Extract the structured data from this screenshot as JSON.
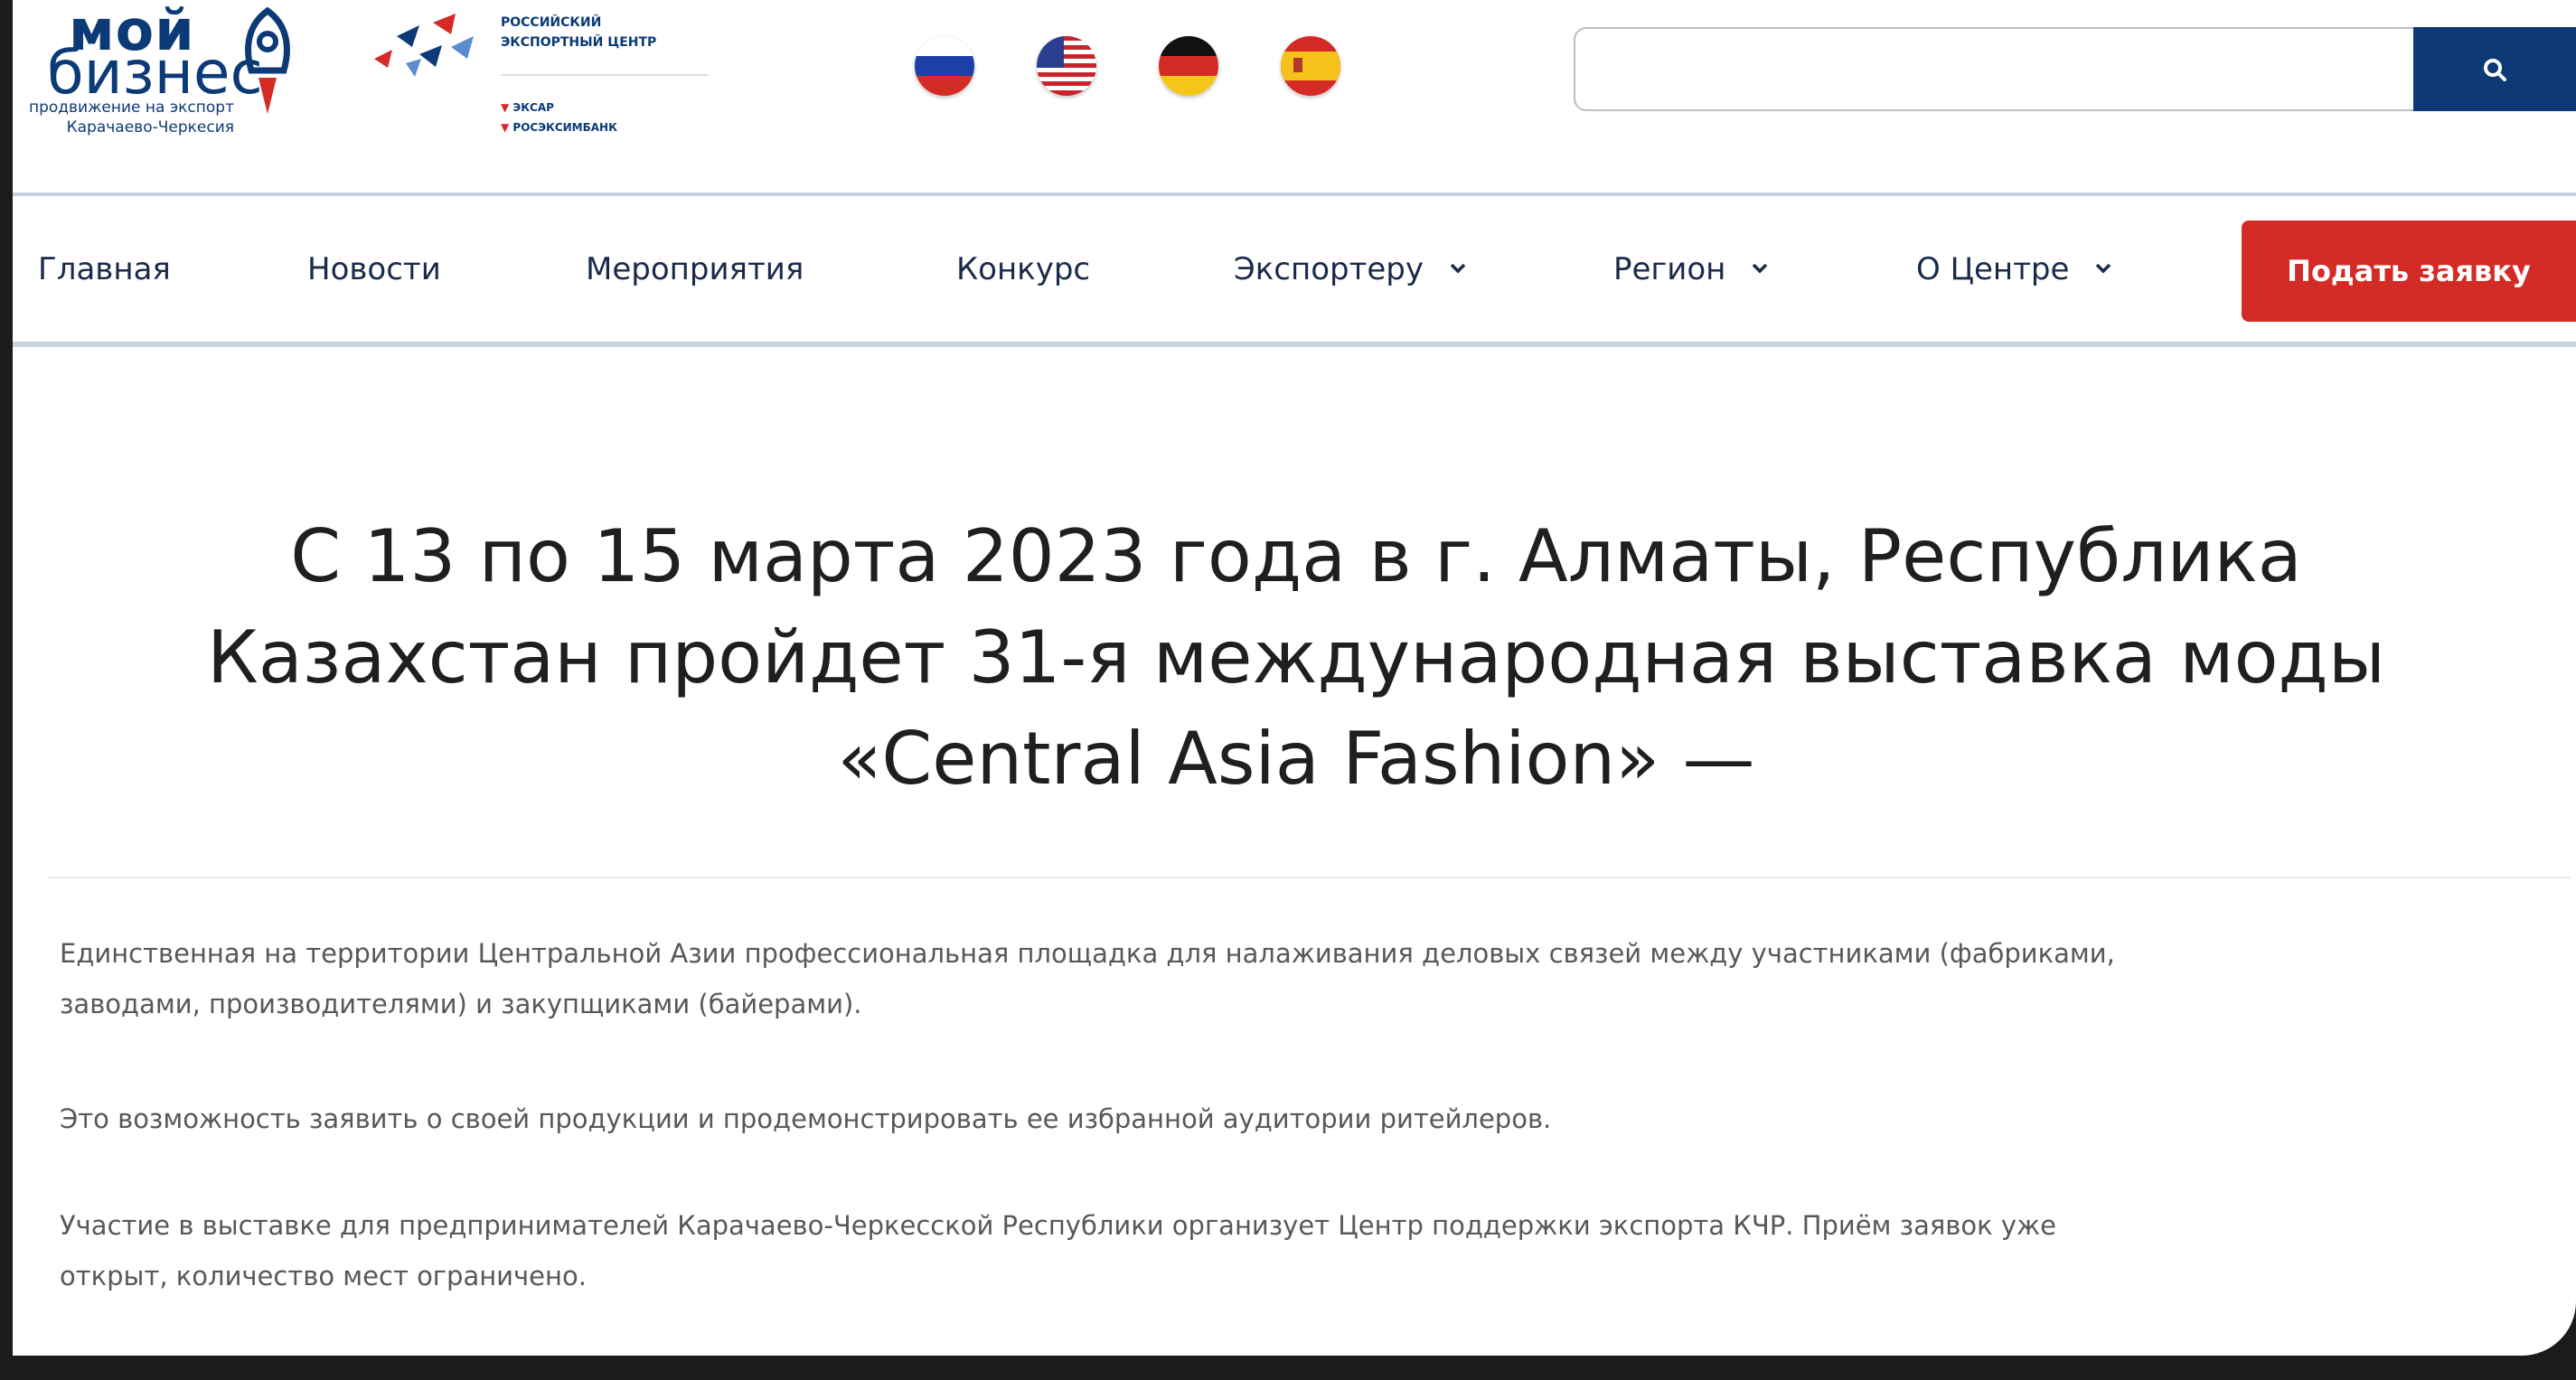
{
  "header": {
    "logo_moy": {
      "top": "мой",
      "mid": "бизнес",
      "sub_line1": "продвижение на экспорт",
      "sub_line2": "Карачаево-Черкесия"
    },
    "logo_rec": {
      "line1": "РОССИЙСКИЙ",
      "line2": "ЭКСПОРТНЫЙ ЦЕНТР",
      "sub1": "ЭКСАР",
      "sub2": "РОСЭКСИМБАНК"
    },
    "flags": [
      "russia-flag",
      "usa-flag",
      "germany-flag",
      "spain-flag"
    ],
    "search": {
      "value": "",
      "placeholder": ""
    }
  },
  "nav": {
    "items": [
      {
        "label": "Главная"
      },
      {
        "label": "Новости"
      },
      {
        "label": "Мероприятия"
      },
      {
        "label": "Конкурс"
      },
      {
        "label": "Экспортеру"
      },
      {
        "label": "Регион"
      },
      {
        "label": "О Центре"
      }
    ],
    "apply_label": "Подать заявку"
  },
  "article": {
    "title_line1": "С 13 по 15 марта 2023 года в г. Алматы, Республика",
    "title_line2": "Казахстан пройдет 31-я международная выставка моды",
    "title_line3": "«Central Asia Fashion» —",
    "p1_line1": "Единственная на территории Центральной Азии профессиональная площадка для налаживания деловых связей между участниками (фабриками,",
    "p1_line2": "заводами, производителями) и закупщиками (байерами).",
    "p2": "Это возможность заявить о своей продукции и продемонстрировать ее избранной аудитории ритейлеров.",
    "p3_line1": "Участие в выставке для предпринимателей Карачаево-Черкесской Республики организует Центр поддержки экспорта КЧР. Приём заявок уже",
    "p3_line2": "открыт, количество мест ограничено."
  },
  "colors": {
    "brand_blue": "#0d3a76",
    "accent_red": "#d42b26",
    "nav_text": "#1a2a4a",
    "body_text": "#585858"
  }
}
